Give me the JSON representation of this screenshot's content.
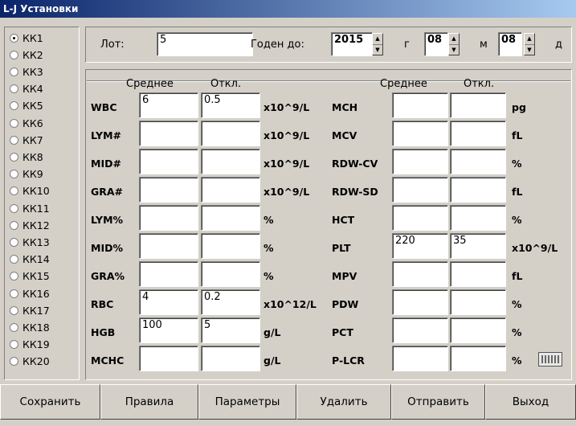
{
  "window": {
    "title": "L-J Установки"
  },
  "controls": {
    "groups": [
      {
        "label": "КК1",
        "checked": true
      },
      {
        "label": "КК2"
      },
      {
        "label": "КК3"
      },
      {
        "label": "КК4"
      },
      {
        "label": "КК5"
      },
      {
        "label": "КК6"
      },
      {
        "label": "КК7"
      },
      {
        "label": "КК8"
      },
      {
        "label": "КК9"
      },
      {
        "label": "КК10"
      },
      {
        "label": "КК11"
      },
      {
        "label": "КК12"
      },
      {
        "label": "КК13"
      },
      {
        "label": "КК14"
      },
      {
        "label": "КК15"
      },
      {
        "label": "КК16"
      },
      {
        "label": "КК17"
      },
      {
        "label": "КК18"
      },
      {
        "label": "КК19"
      },
      {
        "label": "КК20"
      }
    ]
  },
  "lot": {
    "label": "Лот:",
    "value": "5",
    "expiry_label": "Годен до:",
    "year": "2015",
    "year_unit": "г",
    "month": "08",
    "month_unit": "м",
    "day": "08",
    "day_unit": "д"
  },
  "headers": {
    "mean": "Среднее",
    "dev": "Откл."
  },
  "left_params": [
    {
      "name": "WBC",
      "mean": "6",
      "dev": "0.5",
      "unit": "x10^9/L"
    },
    {
      "name": "LYM#",
      "mean": "",
      "dev": "",
      "unit": "x10^9/L"
    },
    {
      "name": "MID#",
      "mean": "",
      "dev": "",
      "unit": "x10^9/L"
    },
    {
      "name": "GRA#",
      "mean": "",
      "dev": "",
      "unit": "x10^9/L"
    },
    {
      "name": "LYM%",
      "mean": "",
      "dev": "",
      "unit": "%"
    },
    {
      "name": "MID%",
      "mean": "",
      "dev": "",
      "unit": "%"
    },
    {
      "name": "GRA%",
      "mean": "",
      "dev": "",
      "unit": "%"
    },
    {
      "name": "RBC",
      "mean": "4",
      "dev": "0.2",
      "unit": "x10^12/L"
    },
    {
      "name": "HGB",
      "mean": "100",
      "dev": "5",
      "unit": "g/L"
    },
    {
      "name": "MCHC",
      "mean": "",
      "dev": "",
      "unit": "g/L"
    }
  ],
  "right_params": [
    {
      "name": "MCH",
      "mean": "",
      "dev": "",
      "unit": "pg"
    },
    {
      "name": "MCV",
      "mean": "",
      "dev": "",
      "unit": "fL"
    },
    {
      "name": "RDW-CV",
      "mean": "",
      "dev": "",
      "unit": "%"
    },
    {
      "name": "RDW-SD",
      "mean": "",
      "dev": "",
      "unit": "fL"
    },
    {
      "name": "HCT",
      "mean": "",
      "dev": "",
      "unit": "%"
    },
    {
      "name": "PLT",
      "mean": "220",
      "dev": "35",
      "unit": "x10^9/L"
    },
    {
      "name": "MPV",
      "mean": "",
      "dev": "",
      "unit": "fL"
    },
    {
      "name": "PDW",
      "mean": "",
      "dev": "",
      "unit": "%"
    },
    {
      "name": "PCT",
      "mean": "",
      "dev": "",
      "unit": "%"
    },
    {
      "name": "P-LCR",
      "mean": "",
      "dev": "",
      "unit": "%"
    }
  ],
  "keyboard_icon": "keyboard-icon",
  "buttons": {
    "save": "Сохранить",
    "rules": "Правила",
    "params": "Параметры",
    "delete": "Удалить",
    "send": "Отправить",
    "exit": "Выход"
  },
  "colors": {
    "titlebar_start": "#0a246a",
    "titlebar_end": "#a6caf0",
    "face": "#d4d0c8"
  }
}
